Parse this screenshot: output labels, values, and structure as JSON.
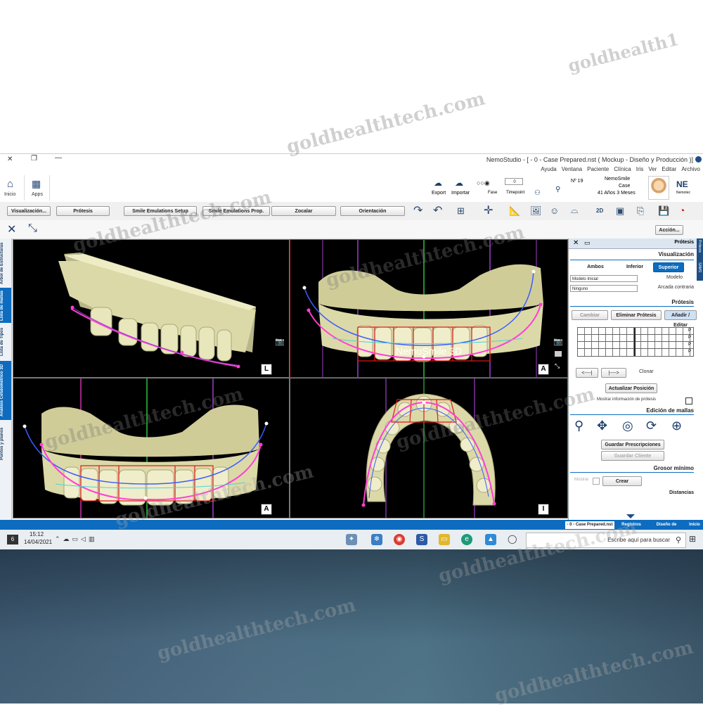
{
  "window": {
    "title": "NemoStudio - [ - 0 - Case Prepared.nst ( Mockup - Diseño y Producción )]",
    "close_glyph": "✕",
    "max_glyph": "❐",
    "min_glyph": "—"
  },
  "menu": [
    "Archivo",
    "Editar",
    "Ver",
    "Iris",
    "Clínica",
    "Paciente",
    "Ventana",
    "Ayuda"
  ],
  "ribbon": {
    "logo": "NE",
    "logo_sub": "Nemotec",
    "patient_name": "NemoSmile",
    "patient_case": "Case",
    "patient_age": "41 Años 3 Meses",
    "patient_no": "Nº 19",
    "time_label": "Timepoint",
    "time_value": "0",
    "fase_label": "Fase",
    "importar_label": "Importar",
    "export_label": "Export",
    "apps_label": "Apps",
    "inicio_label": "Inicio"
  },
  "toolbar": {
    "buttons": [
      "Visualización...",
      "Prótesis",
      "Smile Emulations Setup",
      "Smile Emulations Prop.",
      "Zocalar",
      "Orientación"
    ],
    "view_2d": "2D"
  },
  "actionbar": {
    "accion_label": "Acción..."
  },
  "viewports": [
    {
      "id": "L",
      "label": "L"
    },
    {
      "id": "A-top",
      "label": "A",
      "brand": "NemoSmile 3D"
    },
    {
      "id": "A-bottom",
      "label": "A"
    },
    {
      "id": "I",
      "label": "I"
    }
  ],
  "left_tabs": [
    "Árbol de Estructuras",
    "Lista de mallas",
    "Lista de Tipos",
    "Análisis Cefalométrico 3D",
    "Puntos y planos"
  ],
  "panel": {
    "header": "Prótesis",
    "side_tabs": [
      "Prótesis",
      "SAMS"
    ],
    "visualizacion": "Visualización",
    "view_buttons": [
      "Superior",
      "Inferior",
      "Ambos"
    ],
    "modelo_label": "Modelo",
    "modelo_value": "Modelo Inicial",
    "arcada_label": "Arcada contraria",
    "arcada_value": "Ninguno",
    "protesis_title": "Prótesis",
    "protesis_buttons": [
      "Añadir / Editar",
      "Eliminar Prótesis",
      "Cambiar"
    ],
    "tooth_row_labels": [
      "P",
      "P",
      "P",
      "P"
    ],
    "clonar_label": "Clonar",
    "actualizar_btn": "Actualizar Posición",
    "mostrar_label": "Mostrar información de prótesis",
    "edicion_title": "Edición de mallas",
    "guardar_btn": "Guardar Prescripciones",
    "guardar_cliente_btn": "Guardar Cliente",
    "grosor_title": "Grosor mínimo",
    "crear_btn": "Crear",
    "mostrar2_label": "Mostrar",
    "distancias_title": "Distancias"
  },
  "bottom_tabs": [
    "Inicio",
    "Diseño de Plantillas",
    "Registros",
    "- 0 - Case Prepared.nst"
  ],
  "taskbar": {
    "search_placeholder": "Escribe aquí para buscar",
    "time": "15:12",
    "date": "14/04/2021",
    "notif_count": "6"
  },
  "watermark": [
    "goldhealth1",
    "goldhealthtech.com",
    "goldhealthtech.com",
    "goldhealthtech.com",
    "goldhealthtech.com",
    "goldhealthtech.com",
    "goldhealthtech.com",
    "goldhealthtech.com",
    "goldhealthtech.com",
    "goldhealthtech.com"
  ],
  "colors": {
    "accent_blue": "#0d6cbf",
    "viewport_bg": "#000000",
    "tooth": "#dcd9a8",
    "arch_pink": "#ff3fd6",
    "arch_blue": "#3a5cff",
    "guide_red": "#e01818",
    "guide_green": "#2fbf3c",
    "guide_purple": "#9b3fc9"
  }
}
